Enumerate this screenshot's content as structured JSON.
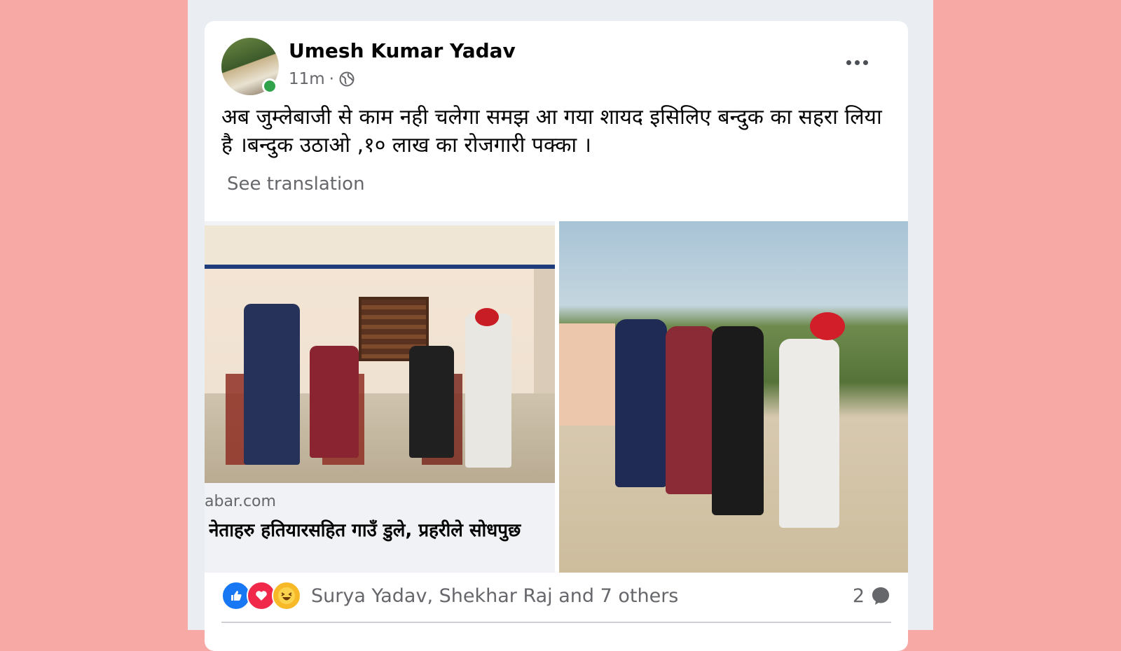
{
  "post": {
    "author": "Umesh Kumar Yadav",
    "time": "11m",
    "separator": "·",
    "text": "अब जुम्लेबाजी से काम नही चलेगा समझ आ गया  शायद इसिलिए   बन्दुक का सहरा लिया है ।बन्दुक उठाओ ,१० लाख का रोजगारी पक्का ।",
    "see_translation": "See translation"
  },
  "link_preview": {
    "domain": "abar.com",
    "headline": "नेताहरु हतियारसहित गाउँ डुले, प्रहरीले सोधपुछ"
  },
  "reactions": {
    "icons": [
      "like-icon",
      "love-icon",
      "haha-icon"
    ],
    "names": "Surya Yadav, Shekhar Raj and 7 others",
    "comment_count": "2"
  },
  "colors": {
    "page_bg": "#f7a9a6",
    "card_bg": "#ffffff",
    "secondary_text": "#65676b",
    "like_blue": "#1877f2",
    "love_red": "#f02849",
    "online_green": "#31a24c"
  }
}
